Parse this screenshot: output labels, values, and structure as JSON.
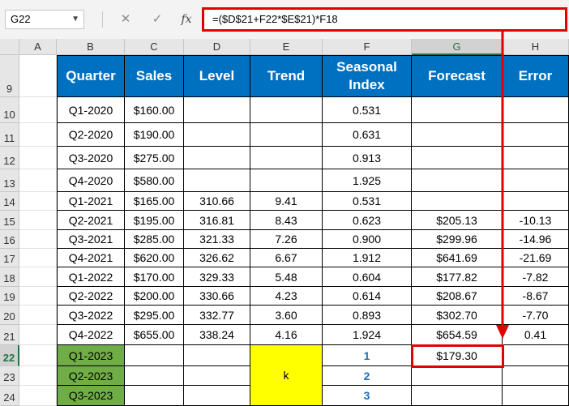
{
  "formula_bar": {
    "name_box": "G22",
    "cancel_icon": "✕",
    "enter_icon": "✓",
    "fx_label": "fx",
    "formula": "=($D$21+F22*$E$21)*F18"
  },
  "columns": [
    "A",
    "B",
    "C",
    "D",
    "E",
    "F",
    "G",
    "H"
  ],
  "rows": [
    "9",
    "10",
    "11",
    "12",
    "13",
    "14",
    "15",
    "16",
    "17",
    "18",
    "19",
    "20",
    "21",
    "22",
    "23",
    "24"
  ],
  "headers": [
    "Quarter",
    "Sales",
    "Level",
    "Trend",
    "Seasonal Index",
    "Forecast",
    "Error"
  ],
  "data": [
    [
      "Q1-2020",
      "$160.00",
      "",
      "",
      "0.531",
      "",
      ""
    ],
    [
      "Q2-2020",
      "$190.00",
      "",
      "",
      "0.631",
      "",
      ""
    ],
    [
      "Q3-2020",
      "$275.00",
      "",
      "",
      "0.913",
      "",
      ""
    ],
    [
      "Q4-2020",
      "$580.00",
      "",
      "",
      "1.925",
      "",
      ""
    ],
    [
      "Q1-2021",
      "$165.00",
      "310.66",
      "9.41",
      "0.531",
      "",
      ""
    ],
    [
      "Q2-2021",
      "$195.00",
      "316.81",
      "8.43",
      "0.623",
      "$205.13",
      "-10.13"
    ],
    [
      "Q3-2021",
      "$285.00",
      "321.33",
      "7.26",
      "0.900",
      "$299.96",
      "-14.96"
    ],
    [
      "Q4-2021",
      "$620.00",
      "326.62",
      "6.67",
      "1.912",
      "$641.69",
      "-21.69"
    ],
    [
      "Q1-2022",
      "$170.00",
      "329.33",
      "5.48",
      "0.604",
      "$177.82",
      "-7.82"
    ],
    [
      "Q2-2022",
      "$200.00",
      "330.66",
      "4.23",
      "0.614",
      "$208.67",
      "-8.67"
    ],
    [
      "Q3-2022",
      "$295.00",
      "332.77",
      "3.60",
      "0.893",
      "$302.70",
      "-7.70"
    ],
    [
      "Q4-2022",
      "$655.00",
      "338.24",
      "4.16",
      "1.924",
      "$654.59",
      "0.41"
    ]
  ],
  "forecast_rows": [
    {
      "quarter": "Q1-2023",
      "index": "1",
      "forecast": "$179.30"
    },
    {
      "quarter": "Q2-2023",
      "index": "2",
      "forecast": ""
    },
    {
      "quarter": "Q3-2023",
      "index": "3",
      "forecast": ""
    }
  ],
  "merged_trend_label": "k",
  "colors": {
    "header_blue": "#0070c0",
    "quarter_green": "#70ad47",
    "trend_yellow": "#ffff00",
    "highlight_red": "#e00000",
    "index_blue": "#1f6fb5"
  }
}
